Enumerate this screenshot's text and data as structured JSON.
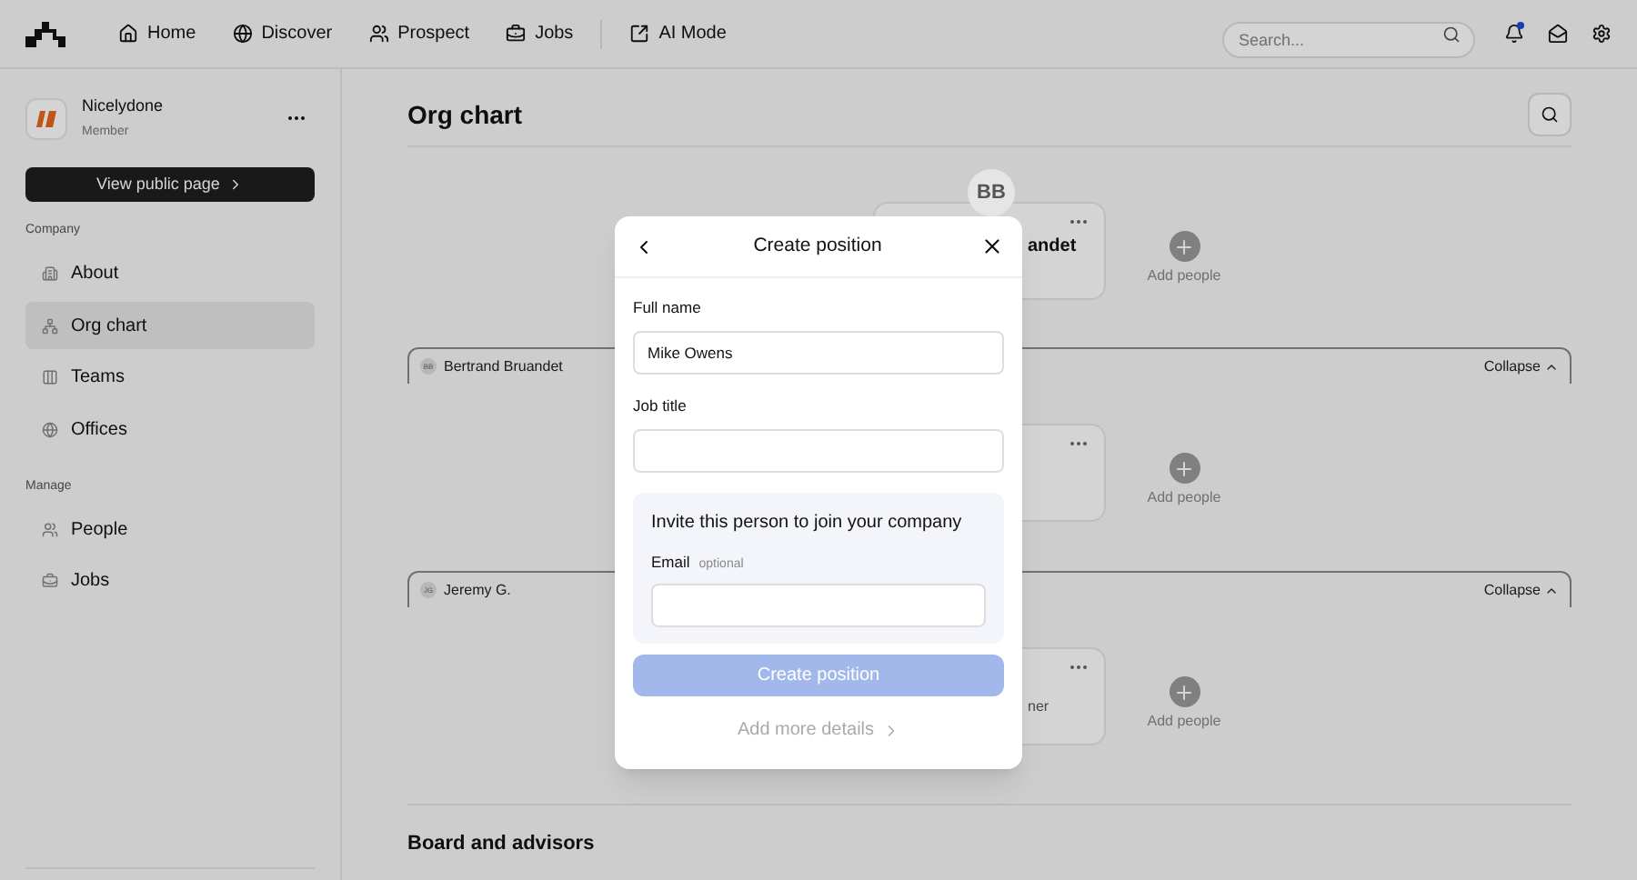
{
  "top_nav": {
    "items": [
      {
        "label": "Home",
        "selected": false
      },
      {
        "label": "Discover",
        "selected": false
      },
      {
        "label": "Prospect",
        "selected": false
      },
      {
        "label": "Jobs",
        "selected": false
      },
      {
        "label": "AI Mode",
        "selected": false
      }
    ],
    "search": {
      "placeholder": "Search..."
    },
    "has_notification": true
  },
  "sidebar": {
    "company": {
      "name": "Nicelydone",
      "role": "Member"
    },
    "public_button": "View public page",
    "sections": [
      {
        "title": "Company",
        "items": [
          {
            "label": "About",
            "selected": false
          },
          {
            "label": "Org chart",
            "selected": true
          },
          {
            "label": "Teams",
            "selected": false
          },
          {
            "label": "Offices",
            "selected": false
          }
        ]
      },
      {
        "title": "Manage",
        "items": [
          {
            "label": "People",
            "selected": false
          },
          {
            "label": "Jobs",
            "selected": false
          }
        ]
      }
    ]
  },
  "main": {
    "title": "Org chart",
    "org_chart": {
      "rows": [
        {
          "avatar": "BB",
          "name": "andet",
          "add_label": "Add people"
        },
        {
          "add_label": "Add people"
        },
        {
          "name": "ner",
          "add_label": "Add people"
        }
      ],
      "groups": [
        {
          "initials": "BB",
          "name": "Bertrand Bruandet",
          "toggle": "Collapse"
        },
        {
          "initials": "JG",
          "name": "Jeremy G.",
          "toggle": "Collapse"
        }
      ]
    },
    "board_title": "Board and advisors"
  },
  "modal": {
    "title": "Create position",
    "fields": [
      {
        "label": "Full name",
        "value": "Mike Owens"
      },
      {
        "label": "Job title"
      }
    ],
    "invite": {
      "title": "Invite this person to join your company",
      "email_label": "Email",
      "email_hint": "optional"
    },
    "submit": {
      "label": "Create position",
      "disabled": true
    },
    "more_link": "Add more details"
  }
}
